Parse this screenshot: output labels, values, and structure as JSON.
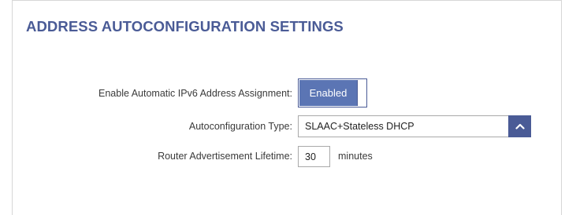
{
  "section": {
    "title": "ADDRESS AUTOCONFIGURATION SETTINGS"
  },
  "fields": {
    "auto_assign": {
      "label": "Enable Automatic IPv6 Address Assignment:",
      "state": "Enabled"
    },
    "autoconfig_type": {
      "label": "Autoconfiguration Type:",
      "value": "SLAAC+Stateless DHCP",
      "icon": "chevron-up-icon"
    },
    "ra_lifetime": {
      "label": "Router Advertisement Lifetime:",
      "value": "30",
      "unit": "minutes"
    }
  },
  "colors": {
    "accent": "#4a5b96",
    "toggle_on": "#5b75b4",
    "border": "#a9a9a9"
  }
}
